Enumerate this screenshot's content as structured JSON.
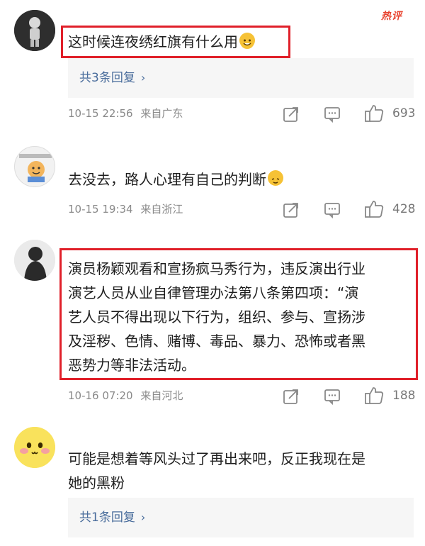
{
  "badge": "热评",
  "comments": [
    {
      "text": "这时候连夜绣红旗有什么用",
      "replies": "共3条回复",
      "time": "10-15 22:56",
      "location": "来自广东",
      "likes": "693"
    },
    {
      "text": "去没去，路人心理有自己的判断",
      "time": "10-15 19:34",
      "location": "来自浙江",
      "likes": "428"
    },
    {
      "lines": [
        "演员杨颖观看和宣扬疯马秀行为，违反演出行业",
        "演艺人员从业自律管理办法第八条第四项：“演",
        "艺人员不得出现以下行为，组织、参与、宣扬涉",
        "及淫秽、色情、赌博、毒品、暴力、恐怖或者黑",
        "恶势力等非法活动。"
      ],
      "time": "10-16 07:20",
      "location": "来自河北",
      "likes": "188"
    },
    {
      "lines": [
        "可能是想着等风头过了再出来吧，反正我现在是",
        "她的黑粉"
      ],
      "replies": "共1条回复"
    }
  ],
  "colors": {
    "highlight_border": "#e0202a",
    "reply_link": "#4a6d9c",
    "meta_gray": "#8a8a8a"
  },
  "icons": [
    "share-icon",
    "comment-icon",
    "like-thumb-icon",
    "chevron-right-icon"
  ]
}
